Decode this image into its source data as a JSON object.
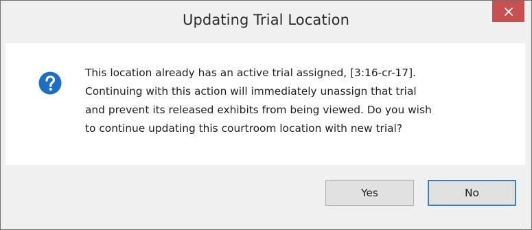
{
  "window": {
    "title": "Updating Trial Location",
    "close_icon": "close-icon"
  },
  "message": {
    "icon": "question-mark-icon",
    "text": "This location already has an active trial assigned, [3:16-cr-17].\nContinuing with this action will immediately unassign that trial\nand prevent its released exhibits from being viewed. Do you wish\nto continue updating this courtroom location with new trial?"
  },
  "buttons": {
    "yes_label": "Yes",
    "no_label": "No"
  },
  "colors": {
    "close_button": "#c75050",
    "icon_blue": "#1e6fc4",
    "focus_border": "#3c7fb1"
  }
}
